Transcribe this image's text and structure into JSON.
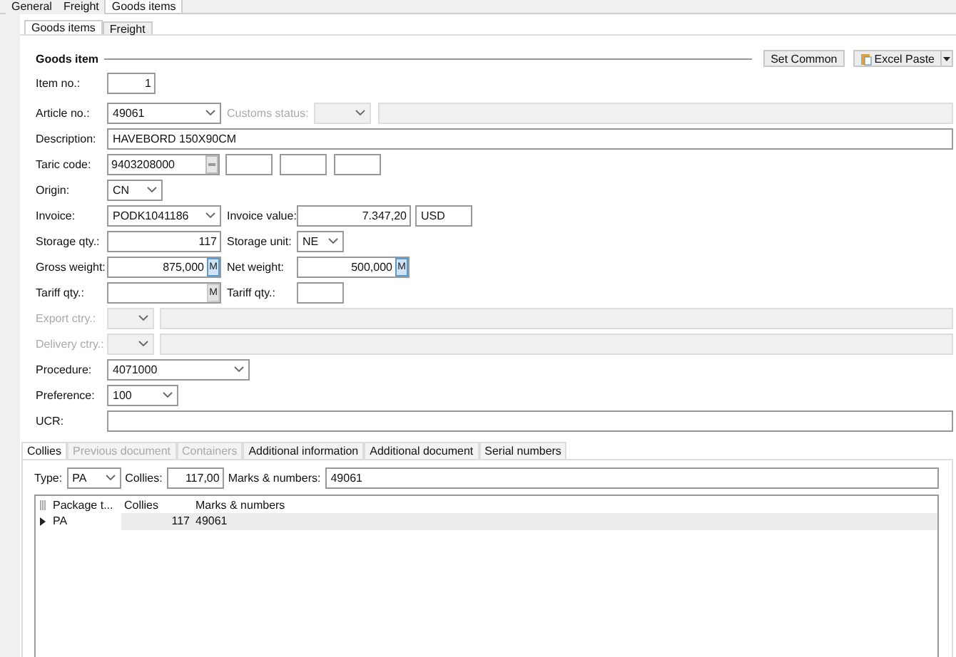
{
  "top_tabs": [
    {
      "label": "General",
      "selected": false
    },
    {
      "label": "Freight",
      "selected": false
    },
    {
      "label": "Goods items",
      "selected": true
    }
  ],
  "sub_tabs": [
    {
      "label": "Goods items",
      "selected": true
    },
    {
      "label": "Freight",
      "selected": false
    }
  ],
  "section": {
    "title": "Goods item",
    "buttons": [
      {
        "label": "Set Common",
        "kind": "plain"
      },
      {
        "label": "Excel Paste",
        "kind": "split"
      }
    ]
  },
  "rows": [
    {
      "label": "Item no.:",
      "disabled": false,
      "controls": [
        {
          "kind": "input",
          "value": "1",
          "disabled": false
        }
      ]
    },
    {
      "label": "Article no.:",
      "disabled": false,
      "controls": [
        {
          "kind": "combo",
          "value": "49061",
          "disabled": false
        },
        {
          "kind": "label",
          "value": "Customs status:",
          "disabled": true
        },
        {
          "kind": "combo",
          "disabled": true
        },
        {
          "kind": "input",
          "disabled": true
        }
      ]
    },
    {
      "label": "Description:",
      "disabled": false,
      "controls": [
        {
          "kind": "input",
          "value": "HAVEBORD 150X90CM",
          "disabled": false
        }
      ]
    },
    {
      "label": "Taric code:",
      "disabled": false,
      "controls": [
        {
          "kind": "input",
          "value": "9403208000",
          "disabled": false,
          "button": {
            "kind": "lookup"
          }
        },
        {
          "kind": "input",
          "disabled": false
        },
        {
          "kind": "input",
          "disabled": false
        },
        {
          "kind": "input",
          "disabled": false
        }
      ]
    },
    {
      "label": "Origin:",
      "disabled": false,
      "controls": [
        {
          "kind": "combo",
          "value": "CN",
          "disabled": false
        }
      ]
    },
    {
      "label": "Invoice:",
      "disabled": false,
      "controls": [
        {
          "kind": "combo",
          "value": "PODK1041186",
          "disabled": false
        },
        {
          "kind": "label",
          "value": "Invoice value:",
          "disabled": false
        },
        {
          "kind": "input",
          "value": "7.347,20",
          "disabled": false
        },
        {
          "kind": "input",
          "value": "USD",
          "disabled": false
        }
      ]
    },
    {
      "label": "Storage qty.:",
      "disabled": false,
      "controls": [
        {
          "kind": "input",
          "value": "117",
          "disabled": false
        },
        {
          "kind": "label",
          "value": "Storage unit:",
          "disabled": false
        },
        {
          "kind": "combo",
          "value": "NE",
          "disabled": false
        }
      ]
    },
    {
      "label": "Gross weight:",
      "disabled": false,
      "controls": [
        {
          "kind": "input",
          "value": "875,000",
          "disabled": false,
          "button": {
            "kind": "mode",
            "label": "M",
            "active": true
          }
        },
        {
          "kind": "label",
          "value": "Net weight:",
          "disabled": false
        },
        {
          "kind": "input",
          "value": "500,000",
          "disabled": false,
          "button": {
            "kind": "mode",
            "label": "M",
            "active": true
          }
        }
      ]
    },
    {
      "label": "Tariff qty.:",
      "disabled": false,
      "controls": [
        {
          "kind": "input",
          "disabled": false,
          "button": {
            "kind": "mode",
            "label": "M",
            "active": false
          }
        },
        {
          "kind": "label",
          "value": "Tariff qty.:",
          "disabled": false
        },
        {
          "kind": "input",
          "disabled": false
        }
      ]
    },
    {
      "label": "Export ctry.:",
      "disabled": true,
      "controls": [
        {
          "kind": "combo",
          "disabled": true
        },
        {
          "kind": "input",
          "disabled": true
        }
      ]
    },
    {
      "label": "Delivery ctry.:",
      "disabled": true,
      "controls": [
        {
          "kind": "combo",
          "disabled": true
        },
        {
          "kind": "input",
          "disabled": true
        }
      ]
    },
    {
      "label": "Procedure:",
      "disabled": false,
      "controls": [
        {
          "kind": "combo",
          "value": "4071000",
          "disabled": false
        }
      ]
    },
    {
      "label": "Preference:",
      "disabled": false,
      "controls": [
        {
          "kind": "combo",
          "value": "100",
          "disabled": false
        }
      ]
    },
    {
      "label": "UCR:",
      "disabled": false,
      "controls": [
        {
          "kind": "input",
          "disabled": false
        }
      ]
    }
  ],
  "collies_tabs": [
    {
      "label": "Collies",
      "selected": true,
      "disabled": false
    },
    {
      "label": "Previous document",
      "selected": false,
      "disabled": true
    },
    {
      "label": "Containers",
      "selected": false,
      "disabled": true
    },
    {
      "label": "Additional information",
      "selected": false,
      "disabled": false
    },
    {
      "label": "Additional document",
      "selected": false,
      "disabled": false
    },
    {
      "label": "Serial numbers",
      "selected": false,
      "disabled": false
    }
  ],
  "collies_filter": {
    "type_label": "Type:",
    "type_value": "PA",
    "collies_label": "Collies:",
    "collies_value": "117,00",
    "marks_label": "Marks & numbers:",
    "marks_value": "49061"
  },
  "grid": {
    "columns": [
      "Package t...",
      "Collies",
      "Marks & numbers"
    ],
    "rows": [
      {
        "cells": [
          "PA",
          "117",
          "49061"
        ],
        "selected": true
      }
    ]
  }
}
